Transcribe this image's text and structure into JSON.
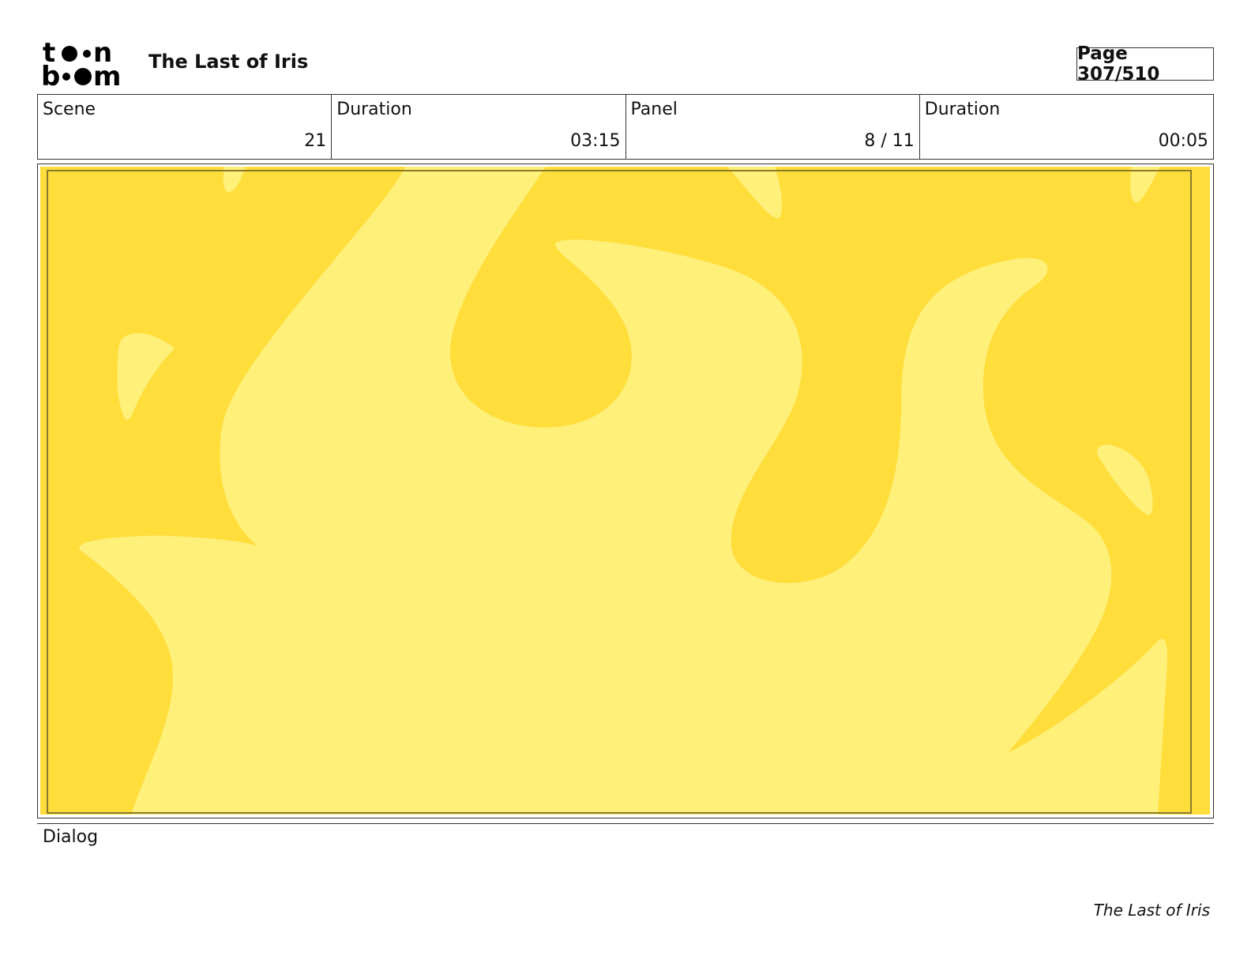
{
  "header": {
    "title": "The Last of Iris",
    "page_label": "Page 307/510"
  },
  "info": {
    "scene_label": "Scene",
    "scene_value": "21",
    "scene_duration_label": "Duration",
    "scene_duration_value": "03:15",
    "panel_label": "Panel",
    "panel_value": "8 / 11",
    "panel_duration_label": "Duration",
    "panel_duration_value": "00:05"
  },
  "dialog": {
    "label": "Dialog"
  },
  "footer": {
    "text": "The Last of Iris"
  },
  "colors": {
    "flame_dark": "#FFDD3A",
    "flame_light": "#FFF07A"
  },
  "logo": {
    "icon": "toon-boom-logo"
  }
}
